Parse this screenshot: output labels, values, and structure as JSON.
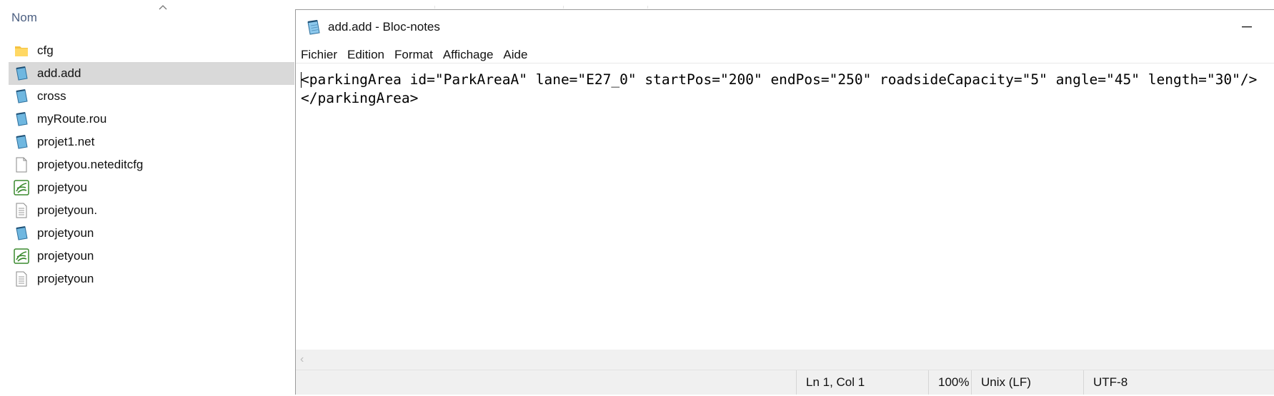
{
  "explorer": {
    "column_header": "Nom",
    "files": [
      {
        "name": "cfg",
        "icon": "folder-icon",
        "selected": false
      },
      {
        "name": "add.add",
        "icon": "notepad-file-icon",
        "selected": true
      },
      {
        "name": "cross",
        "icon": "notepad-file-icon",
        "selected": false
      },
      {
        "name": "myRoute.rou",
        "icon": "notepad-file-icon",
        "selected": false
      },
      {
        "name": "projet1.net",
        "icon": "notepad-file-icon",
        "selected": false
      },
      {
        "name": "projetyou.neteditcfg",
        "icon": "blank-file-icon",
        "selected": false
      },
      {
        "name": "projetyou",
        "icon": "sumo-app-icon",
        "selected": false
      },
      {
        "name": "projetyoun.",
        "icon": "text-file-icon",
        "selected": false
      },
      {
        "name": "projetyoun",
        "icon": "notepad-file-icon",
        "selected": false
      },
      {
        "name": "projetyoun",
        "icon": "sumo-app-icon",
        "selected": false
      },
      {
        "name": "projetyoun",
        "icon": "text-file-icon",
        "selected": false
      }
    ]
  },
  "notepad": {
    "title": "add.add - Bloc-notes",
    "menu": [
      "Fichier",
      "Edition",
      "Format",
      "Affichage",
      "Aide"
    ],
    "content_lines": [
      "<parkingArea id=\"ParkAreaA\" lane=\"E27_0\" startPos=\"200\" endPos=\"250\" roadsideCapacity=\"5\" angle=\"45\" length=\"30\"/>",
      "</parkingArea>"
    ],
    "status": {
      "position": "Ln 1, Col 1",
      "zoom": "100%",
      "line_ending": "Unix (LF)",
      "encoding": "UTF-8"
    },
    "colors": {
      "accent": "#2b79c7",
      "selection": "#d9d9d9",
      "sumo_green": "#3a8a2e"
    }
  }
}
